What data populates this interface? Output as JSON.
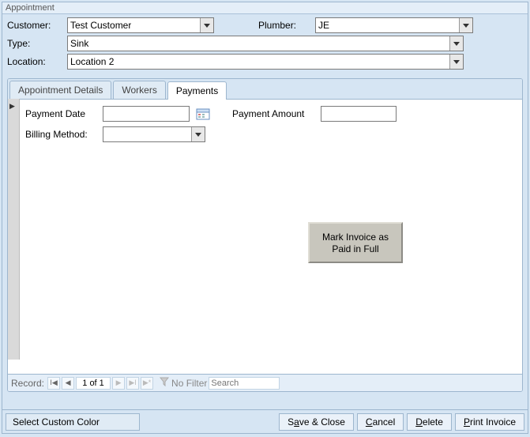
{
  "title": "Appointment",
  "header": {
    "customer_label": "Customer:",
    "customer_value": "Test Customer",
    "plumber_label": "Plumber:",
    "plumber_value": "JE",
    "type_label": "Type:",
    "type_value": "Sink",
    "location_label": "Location:",
    "location_value": "Location 2"
  },
  "tabs": {
    "t0": "Appointment Details",
    "t1": "Workers",
    "t2": "Payments",
    "active": "Payments"
  },
  "payments": {
    "payment_date_label": "Payment Date",
    "payment_date_value": "",
    "payment_amount_label": "Payment Amount",
    "payment_amount_value": "",
    "billing_method_label": "Billing Method:",
    "billing_method_value": "",
    "mark_paid_line1": "Mark Invoice as",
    "mark_paid_line2": "Paid in Full"
  },
  "nav": {
    "record_label": "Record:",
    "record_pos": "1 of 1",
    "no_filter": "No Filter",
    "search_placeholder": "Search"
  },
  "bottom": {
    "custom_color": "Select Custom Color",
    "save_pre": "S",
    "save_m": "a",
    "save_post": "ve & Close",
    "cancel_m": "C",
    "cancel_post": "ancel",
    "delete_m": "D",
    "delete_post": "elete",
    "print_m": "P",
    "print_post": "rint Invoice"
  }
}
